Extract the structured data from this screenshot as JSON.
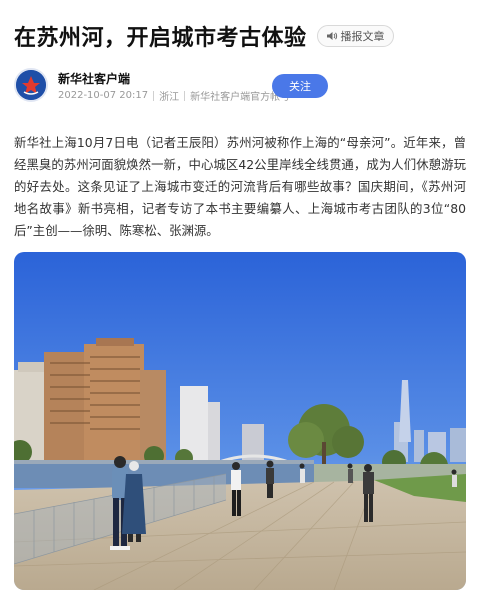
{
  "article": {
    "title": "在苏州河，开启城市考古体验",
    "tts_label": "播报文章",
    "author": {
      "name": "新华社客户端",
      "datetime": "2022-10-07 20:17",
      "location": "浙江",
      "account_note": "新华社客户端官方帐号"
    },
    "follow_label": "关注",
    "body": "新华社上海10月7日电（记者王辰阳）苏州河被称作上海的“母亲河”。近年来，曾经黑臭的苏州河面貌焕然一新，中心城区42公里岸线全线贯通，成为人们休憩游玩的好去处。这条见证了上海城市变迁的河流背后有哪些故事？国庆期间，《苏州河地名故事》新书亮相，记者专访了本书主要编纂人、上海城市考古团队的3位“80后”主创——徐明、陈寒松、张渊源。"
  },
  "colors": {
    "accent": "#4a78e8",
    "avatar_bg": "#1f4fa8",
    "sky_top": "#2b63d8",
    "sky_bottom": "#8fb6f0"
  },
  "icons": {
    "tts": "speaker-icon",
    "avatar": "xinhua-logo-icon"
  }
}
